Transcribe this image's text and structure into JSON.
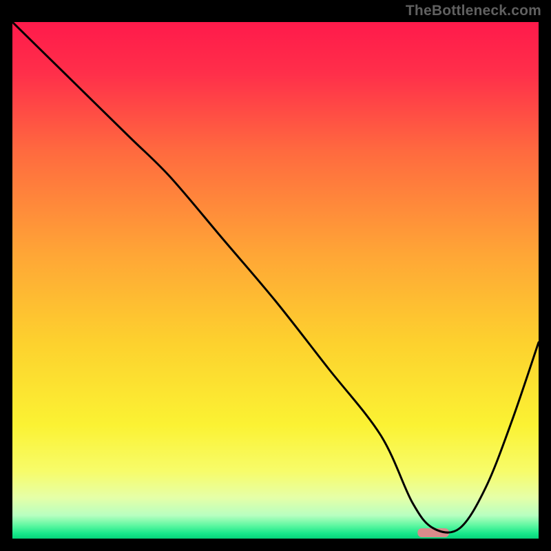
{
  "watermark": "TheBottleneck.com",
  "chart_data": {
    "type": "line",
    "title": "",
    "xlabel": "",
    "ylabel": "",
    "xlim": [
      0,
      100
    ],
    "ylim": [
      0,
      100
    ],
    "series": [
      {
        "name": "curve",
        "x": [
          0,
          10,
          22,
          30,
          40,
          50,
          60,
          70,
          76,
          80,
          85,
          90,
          95,
          100
        ],
        "y": [
          100,
          90,
          78,
          70,
          58,
          46,
          33,
          20,
          7,
          2,
          2,
          10,
          23,
          38
        ]
      }
    ],
    "marker": {
      "x": 80,
      "width": 6,
      "color": "#d98b8b"
    },
    "gradient_stops": [
      {
        "offset": 0.0,
        "color": "#ff1a4b"
      },
      {
        "offset": 0.1,
        "color": "#ff2f4a"
      },
      {
        "offset": 0.25,
        "color": "#ff6a3f"
      },
      {
        "offset": 0.45,
        "color": "#ffa636"
      },
      {
        "offset": 0.62,
        "color": "#fdd12e"
      },
      {
        "offset": 0.78,
        "color": "#fbf233"
      },
      {
        "offset": 0.87,
        "color": "#f7fc6a"
      },
      {
        "offset": 0.92,
        "color": "#e6ffa7"
      },
      {
        "offset": 0.955,
        "color": "#b8ffc0"
      },
      {
        "offset": 0.975,
        "color": "#5cf7a0"
      },
      {
        "offset": 0.99,
        "color": "#18e88b"
      },
      {
        "offset": 1.0,
        "color": "#06d37a"
      }
    ]
  }
}
